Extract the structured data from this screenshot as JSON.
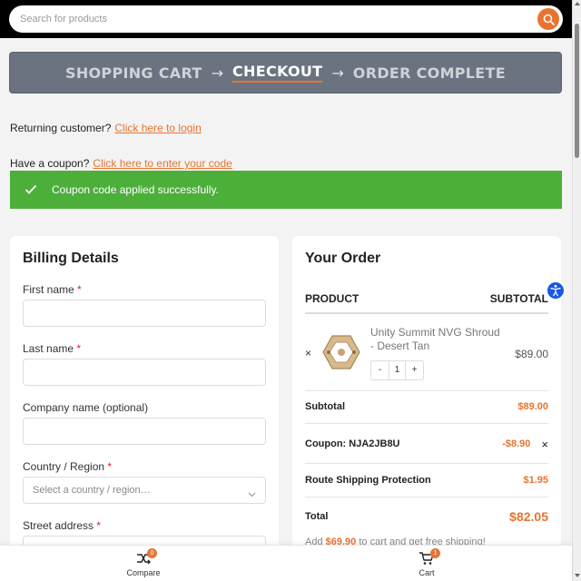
{
  "search": {
    "placeholder": "Search for products"
  },
  "steps": [
    {
      "label": "SHOPPING CART"
    },
    {
      "label": "CHECKOUT"
    },
    {
      "label": "ORDER COMPLETE"
    }
  ],
  "step_arrow": "→",
  "returning": {
    "text": "Returning customer?",
    "link": "Click here to login"
  },
  "coupon_prompt": {
    "text": "Have a coupon?",
    "link": "Click here to enter your code"
  },
  "notice": {
    "text": "Coupon code applied successfully."
  },
  "billing": {
    "title": "Billing Details",
    "fields": {
      "first_name": "First name",
      "last_name": "Last name",
      "company": "Company name (optional)",
      "country": "Country / Region",
      "country_placeholder": "Select a country / region…",
      "street": "Street address"
    },
    "required_mark": "*"
  },
  "order": {
    "title": "Your Order",
    "col_product": "PRODUCT",
    "col_subtotal": "SUBTOTAL",
    "item": {
      "remove": "×",
      "name": "Unity Summit NVG Shroud - Desert Tan",
      "price": "$89.00",
      "qty_minus": "-",
      "qty": "1",
      "qty_plus": "+"
    },
    "subtotal_label": "Subtotal",
    "subtotal_value": "$89.00",
    "coupon_label": "Coupon: NJA2JB8U",
    "coupon_value": "-$8.90",
    "coupon_remove": "×",
    "shipping_label": "Route Shipping Protection",
    "shipping_value": "$1.95",
    "total_label": "Total",
    "total_value": "$82.05",
    "note_prefix": "Add",
    "note_amount": "$69.90",
    "note_suffix": "to cart and get free shipping!"
  },
  "bottom_nav": {
    "compare": {
      "label": "Compare",
      "count": "0"
    },
    "cart": {
      "label": "Cart",
      "count": "1"
    }
  },
  "colors": {
    "accent": "#e8742f",
    "success": "#4caf3a",
    "banner": "#6b7380",
    "a11y": "#1a56e8"
  }
}
